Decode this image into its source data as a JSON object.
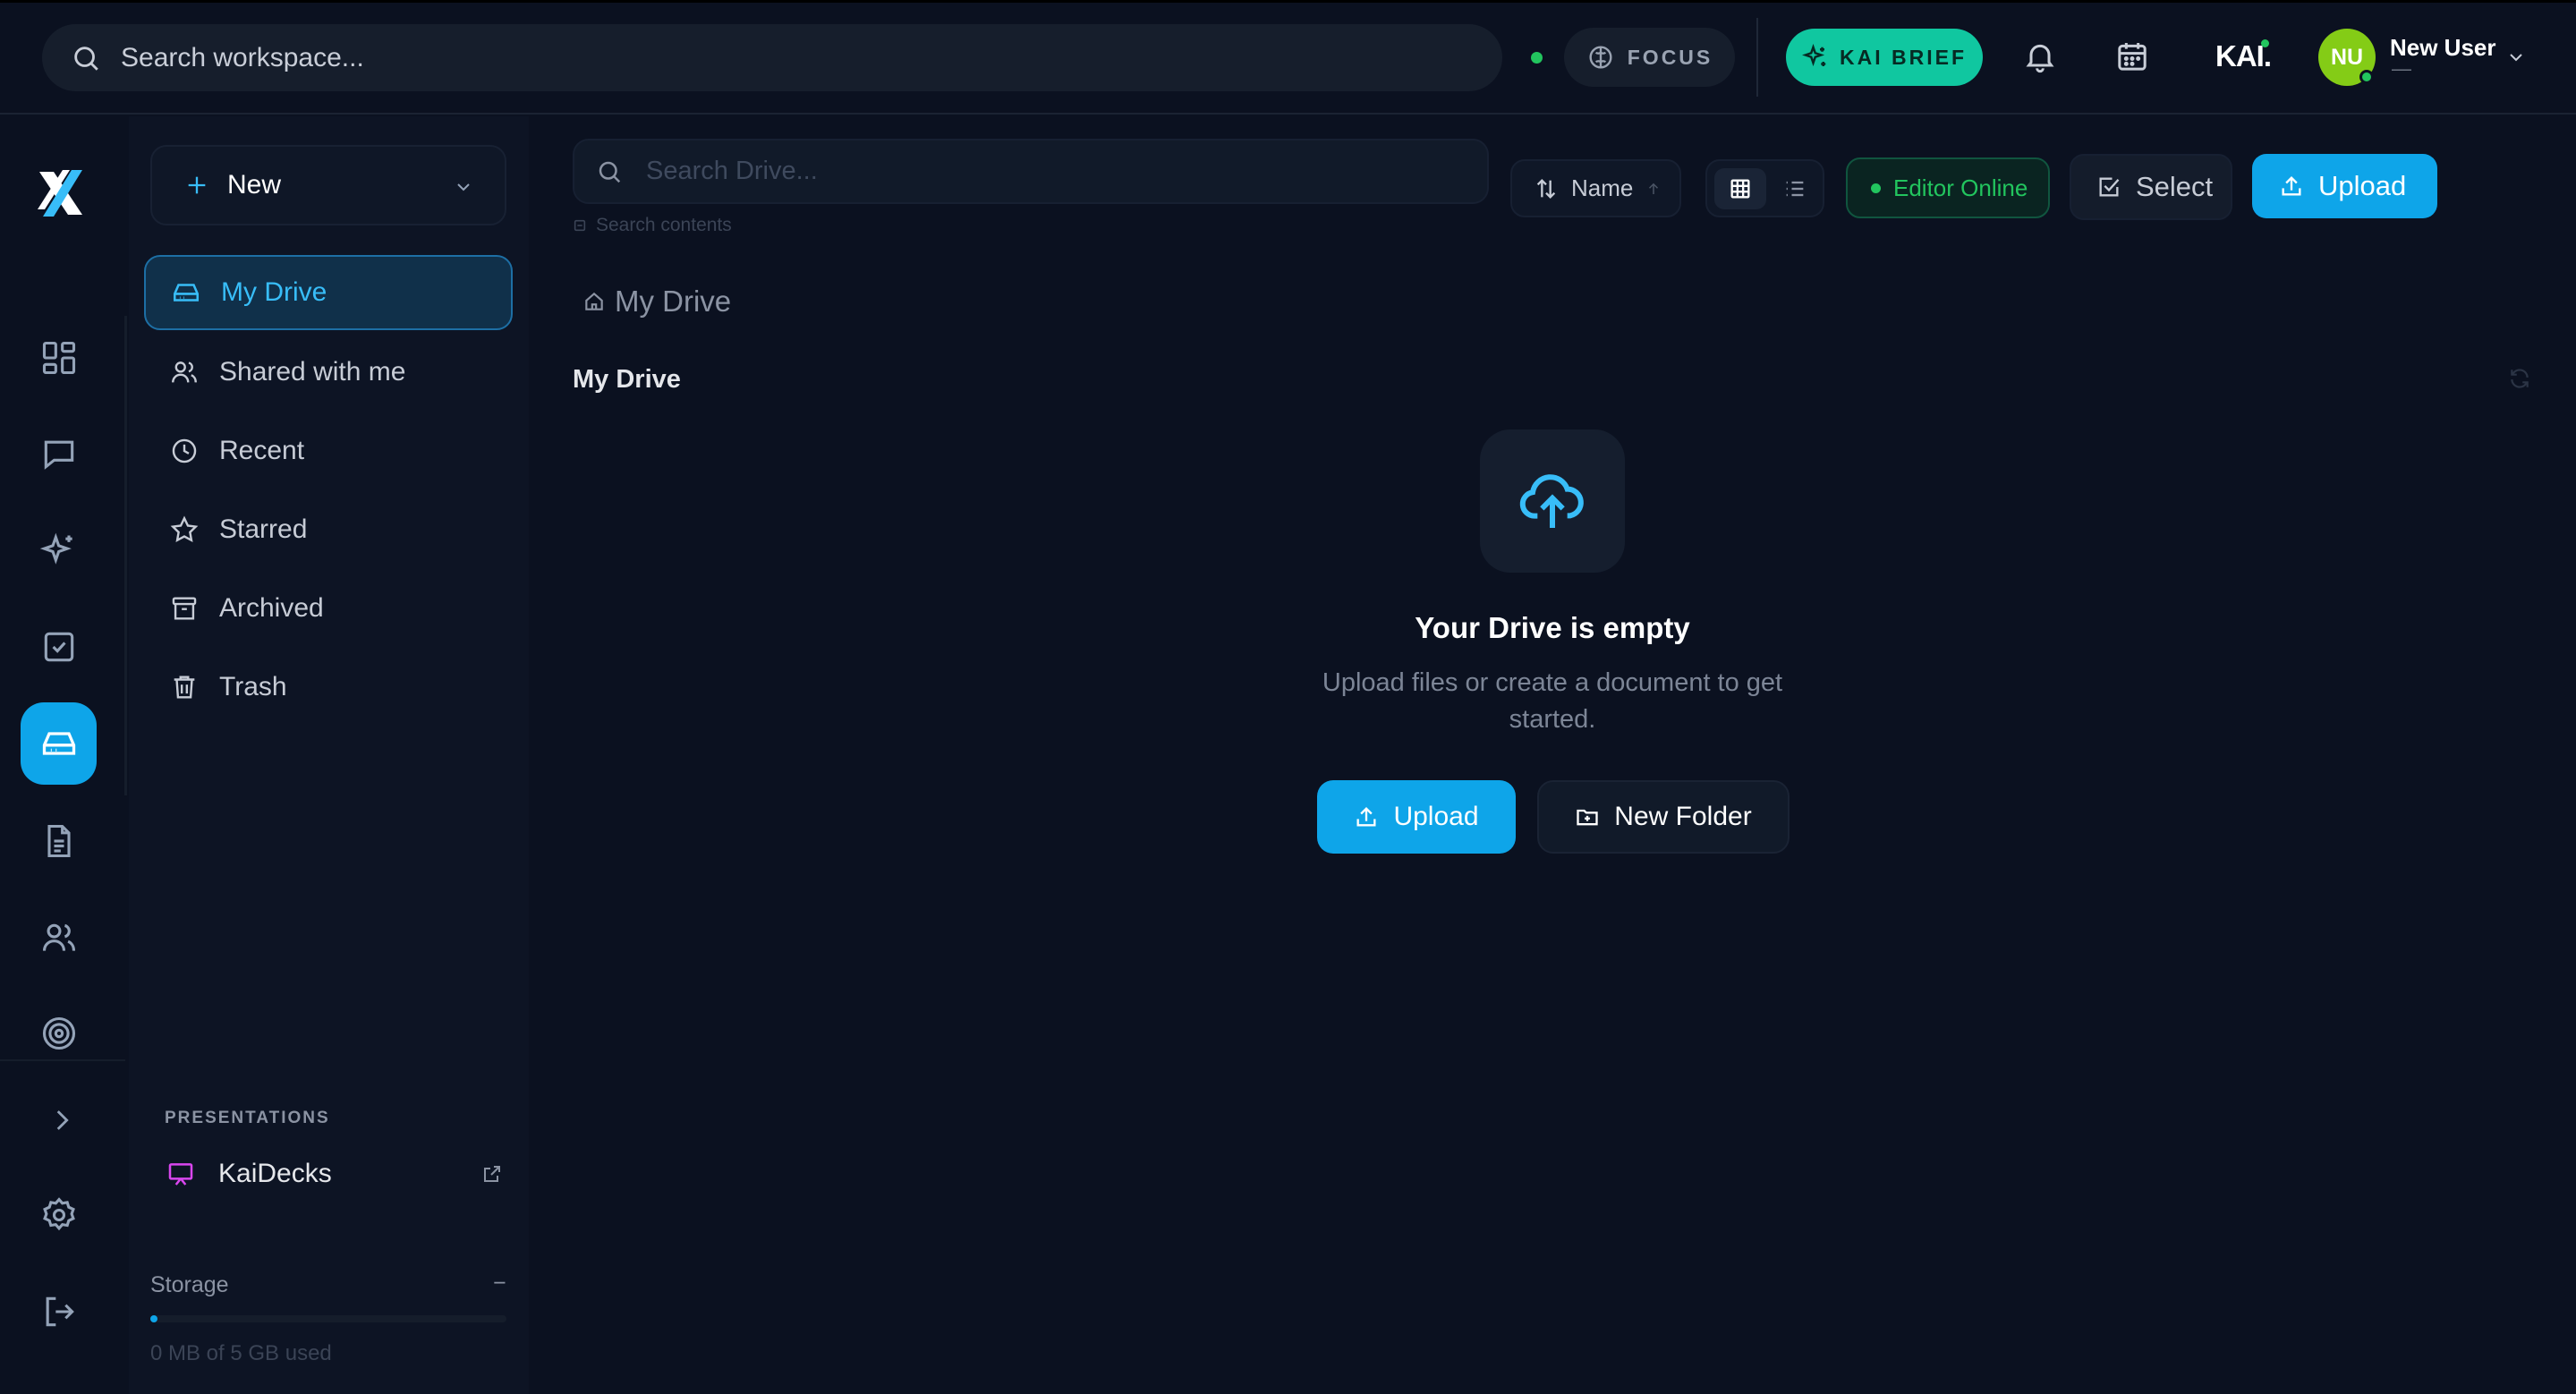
{
  "header": {
    "search_placeholder": "Search workspace...",
    "focus_label": "FOCUS",
    "kai_brief_label": "KAI BRIEF",
    "kai_logo": "KAI.",
    "user": {
      "initials": "NU",
      "name": "New User",
      "subtitle": "—"
    }
  },
  "rail": {
    "items": [
      "dashboard-icon",
      "chat-icon",
      "sparkle-icon",
      "tasks-icon",
      "drive-icon",
      "document-icon",
      "users-icon",
      "target-icon",
      "expand-icon",
      "settings-icon",
      "logout-icon"
    ],
    "active": "drive-icon"
  },
  "sidebar": {
    "new_label": "New",
    "items": [
      {
        "label": "My Drive",
        "icon": "drive-icon",
        "active": true
      },
      {
        "label": "Shared with me",
        "icon": "users-icon"
      },
      {
        "label": "Recent",
        "icon": "clock-icon"
      },
      {
        "label": "Starred",
        "icon": "star-icon"
      },
      {
        "label": "Archived",
        "icon": "archive-icon"
      },
      {
        "label": "Trash",
        "icon": "trash-icon"
      }
    ],
    "presentations_label": "PRESENTATIONS",
    "kaidecks_label": "KaiDecks",
    "storage": {
      "label": "Storage",
      "collapse": "−",
      "used_text": "0 MB of 5 GB used",
      "used_fraction": 0.0
    }
  },
  "toolbar": {
    "search_placeholder": "Search Drive...",
    "search_hint": "Search contents",
    "sort_label": "Name",
    "editor_status": "Editor Online",
    "select_label": "Select",
    "upload_label": "Upload"
  },
  "main": {
    "breadcrumb": "My Drive",
    "title": "My Drive",
    "empty": {
      "title": "Your Drive is empty",
      "subtitle": "Upload files or create a document to get started.",
      "upload_label": "Upload",
      "new_folder_label": "New Folder"
    }
  },
  "colors": {
    "accent": "#0ea5e9",
    "brief": "#10c7a0",
    "online": "#22c55e",
    "background": "#0b1120"
  }
}
